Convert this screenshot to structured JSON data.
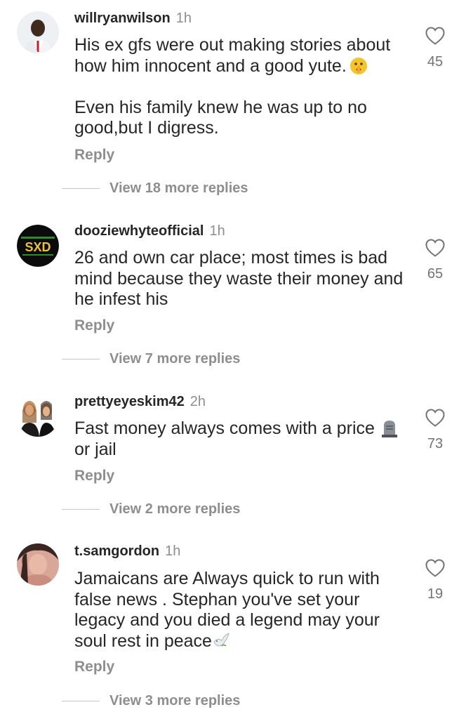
{
  "comments": [
    {
      "username": "willryanwilson",
      "time": "1h",
      "paragraphs": [
        "His ex gfs were out making stories about how him innocent and a good yute.",
        "Even his family knew he was up to no good,but I digress."
      ],
      "emoji": "shushing-face-emoji",
      "reply_label": "Reply",
      "likes": "45",
      "view_replies": "View 18 more replies"
    },
    {
      "username": "dooziewhyteofficial",
      "time": "1h",
      "text": "26 and own car place; most times is bad mind because they waste their money and he infest his",
      "avatar_logo_text": "SXD",
      "reply_label": "Reply",
      "likes": "65",
      "view_replies": "View 7 more replies"
    },
    {
      "username": "prettyeyeskim42",
      "time": "2h",
      "text": "Fast money always comes with a price",
      "text_end": "or jail",
      "emoji": "headstone-emoji",
      "reply_label": "Reply",
      "likes": "73",
      "view_replies": "View 2 more replies"
    },
    {
      "username": "t.samgordon",
      "time": "1h",
      "text": "Jamaicans are Always quick to run with false news . Stephan you've set your legacy and you died a legend may your soul rest in peace",
      "emoji": "dove-emoji",
      "reply_label": "Reply",
      "likes": "19",
      "view_replies": "View 3 more replies"
    }
  ],
  "colors": {
    "text": "#262626",
    "secondary": "#8e8e8e",
    "divider": "#c7c7c7"
  }
}
